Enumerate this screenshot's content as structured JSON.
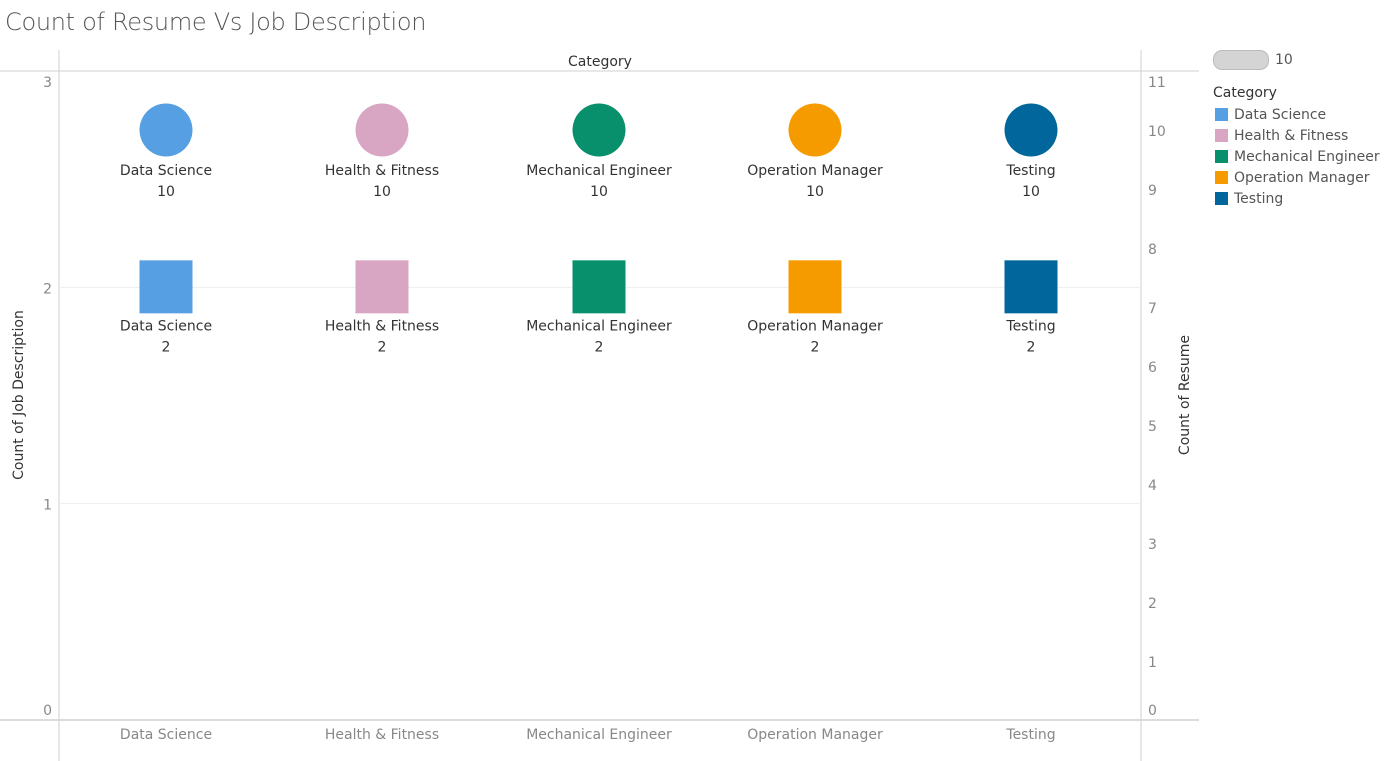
{
  "title": "Count of Resume Vs Job Description",
  "size_legend": {
    "value_label": "10"
  },
  "legend": {
    "title": "Category",
    "items": [
      {
        "label": "Data Science",
        "color": "#559fe2"
      },
      {
        "label": "Health & Fitness",
        "color": "#d8a6c2"
      },
      {
        "label": "Mechanical Engineer",
        "color": "#07906b"
      },
      {
        "label": "Operation Manager",
        "color": "#f59b00"
      },
      {
        "label": "Testing",
        "color": "#00669c"
      }
    ]
  },
  "chart_data": {
    "type": "scatter",
    "title": "Count of Resume Vs Job Description",
    "top_header": "Category",
    "categories": [
      "Data Science",
      "Health & Fitness",
      "Mechanical Engineer",
      "Operation Manager",
      "Testing"
    ],
    "left_axis": {
      "label": "Count of Job Description",
      "ticks": [
        0,
        1,
        2,
        3
      ],
      "range": [
        0,
        3
      ]
    },
    "right_axis": {
      "label": "Count of Resume",
      "ticks": [
        0,
        1,
        2,
        3,
        4,
        5,
        6,
        7,
        8,
        9,
        10,
        11
      ],
      "range": [
        0,
        11
      ]
    },
    "series": [
      {
        "name": "Count of Resume",
        "shape": "circle",
        "axis": "right",
        "values": [
          10,
          10,
          10,
          10,
          10
        ]
      },
      {
        "name": "Count of Job Description",
        "shape": "square",
        "axis": "left",
        "values": [
          2,
          2,
          2,
          2,
          2
        ]
      }
    ],
    "colors": [
      "#559fe2",
      "#d8a6c2",
      "#07906b",
      "#f59b00",
      "#00669c"
    ],
    "grid": true,
    "legend_position": "right"
  }
}
